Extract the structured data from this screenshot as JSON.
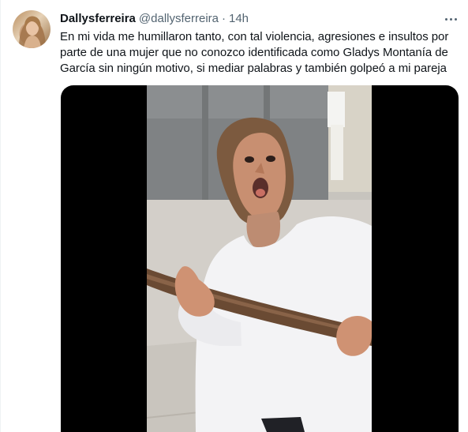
{
  "tweet": {
    "display_name": "Dallysferreira",
    "handle": "@dallysferreira",
    "separator": "·",
    "time": "14h",
    "text": "En mi vida me humillaron tanto, con tal violencia, agresiones e insultos por parte de una mujer que no conozco identificada como Gladys Montanía de García sin ningún motivo, si mediar palabras y también golpeó a mi pareja"
  },
  "icons": {
    "more": "more-horizontal-icon"
  },
  "colors": {
    "text": "#0f1419",
    "secondary": "#536471",
    "media_background": "#000000"
  }
}
